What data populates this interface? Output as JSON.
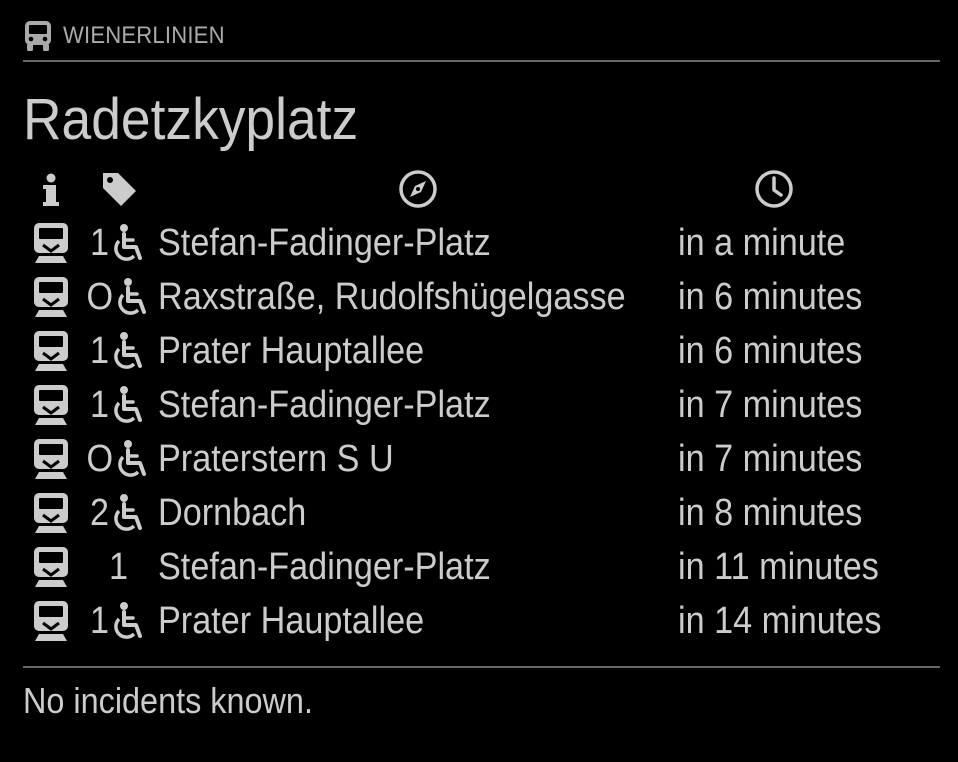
{
  "header": {
    "icon": "bus-icon",
    "title": "WIENERLINIEN"
  },
  "station": "Radetzkyplatz",
  "columns": [
    {
      "icon": "info-icon"
    },
    {
      "icon": "tag-icon"
    },
    {
      "icon": "compass-icon"
    },
    {
      "icon": "clock-icon"
    }
  ],
  "departures": [
    {
      "type_icon": "tram-icon",
      "line": "1",
      "barrier_free": true,
      "direction": "Stefan-Fadinger-Platz",
      "time": "in a minute"
    },
    {
      "type_icon": "tram-icon",
      "line": "O",
      "barrier_free": true,
      "direction": "Raxstraße, Rudolfshügelgasse",
      "time": "in 6 minutes"
    },
    {
      "type_icon": "tram-icon",
      "line": "1",
      "barrier_free": true,
      "direction": "Prater Hauptallee",
      "time": "in 6 minutes"
    },
    {
      "type_icon": "tram-icon",
      "line": "1",
      "barrier_free": true,
      "direction": "Stefan-Fadinger-Platz",
      "time": "in 7 minutes"
    },
    {
      "type_icon": "tram-icon",
      "line": "O",
      "barrier_free": true,
      "direction": "Praterstern S U",
      "time": "in 7 minutes"
    },
    {
      "type_icon": "tram-icon",
      "line": "2",
      "barrier_free": true,
      "direction": "Dornbach",
      "time": "in 8 minutes"
    },
    {
      "type_icon": "tram-icon",
      "line": "1",
      "barrier_free": false,
      "direction": "Stefan-Fadinger-Platz",
      "time": "in 11 minutes"
    },
    {
      "type_icon": "tram-icon",
      "line": "1",
      "barrier_free": true,
      "direction": "Prater Hauptallee",
      "time": "in 14 minutes"
    }
  ],
  "incidents": "No incidents known.",
  "colors": {
    "background": "#000000",
    "text": "#cccccc",
    "muted": "#aaaaaa",
    "divider": "#666666"
  }
}
